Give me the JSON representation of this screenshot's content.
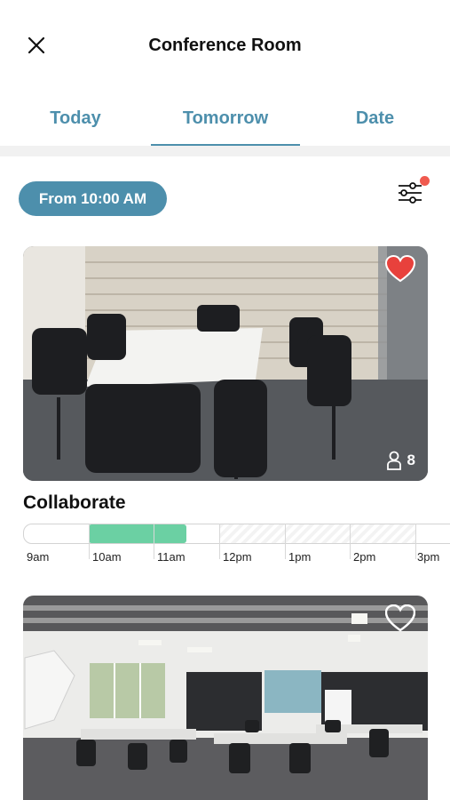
{
  "header": {
    "title": "Conference Room",
    "close_icon": "close-icon"
  },
  "tabs": [
    {
      "label": "Today",
      "active": false
    },
    {
      "label": "Tomorrow",
      "active": true
    },
    {
      "label": "Date",
      "active": false
    }
  ],
  "filters": {
    "from_label": "From 10:00 AM",
    "filter_icon": "sliders-icon",
    "has_active_filters": true
  },
  "rooms": [
    {
      "name": "Collaborate",
      "capacity": "8",
      "favorite": true,
      "timeline": {
        "hours": [
          "9am",
          "10am",
          "11am",
          "12pm",
          "1pm",
          "2pm",
          "3pm"
        ],
        "booked": "10am–11:30am"
      }
    },
    {
      "name": "",
      "favorite": false
    }
  ],
  "colors": {
    "accent": "#4d8fac",
    "booked": "#6bd0a3",
    "favorite": "#e8413c",
    "notification": "#f05a4f"
  }
}
